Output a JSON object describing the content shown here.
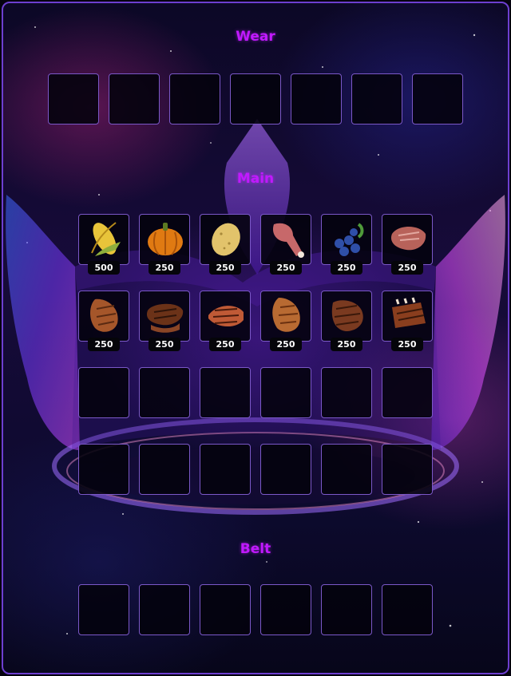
{
  "wear": {
    "title": "Wear",
    "slot_count": 7
  },
  "main": {
    "title": "Main",
    "rows": [
      [
        {
          "item": "corn-icon",
          "qty": "500"
        },
        {
          "item": "pumpkin-icon",
          "qty": "250"
        },
        {
          "item": "potato-icon",
          "qty": "250"
        },
        {
          "item": "raw-meat-icon",
          "qty": "250"
        },
        {
          "item": "blueberries-icon",
          "qty": "250"
        },
        {
          "item": "raw-steak-icon",
          "qty": "250"
        }
      ],
      [
        {
          "item": "cooked-chicken-icon",
          "qty": "250"
        },
        {
          "item": "cooked-steak-icon",
          "qty": "250"
        },
        {
          "item": "grilled-fish-icon",
          "qty": "250"
        },
        {
          "item": "cooked-breast-icon",
          "qty": "250"
        },
        {
          "item": "grilled-meat-icon",
          "qty": "250"
        },
        {
          "item": "cooked-ribs-icon",
          "qty": "250"
        }
      ],
      [
        null,
        null,
        null,
        null,
        null,
        null
      ],
      [
        null,
        null,
        null,
        null,
        null,
        null
      ]
    ]
  },
  "belt": {
    "title": "Belt",
    "slot_count": 6
  },
  "colors": {
    "title": "#c119ff",
    "slot_border": "#7b58c8",
    "frame_border": "#6d3fd0"
  }
}
